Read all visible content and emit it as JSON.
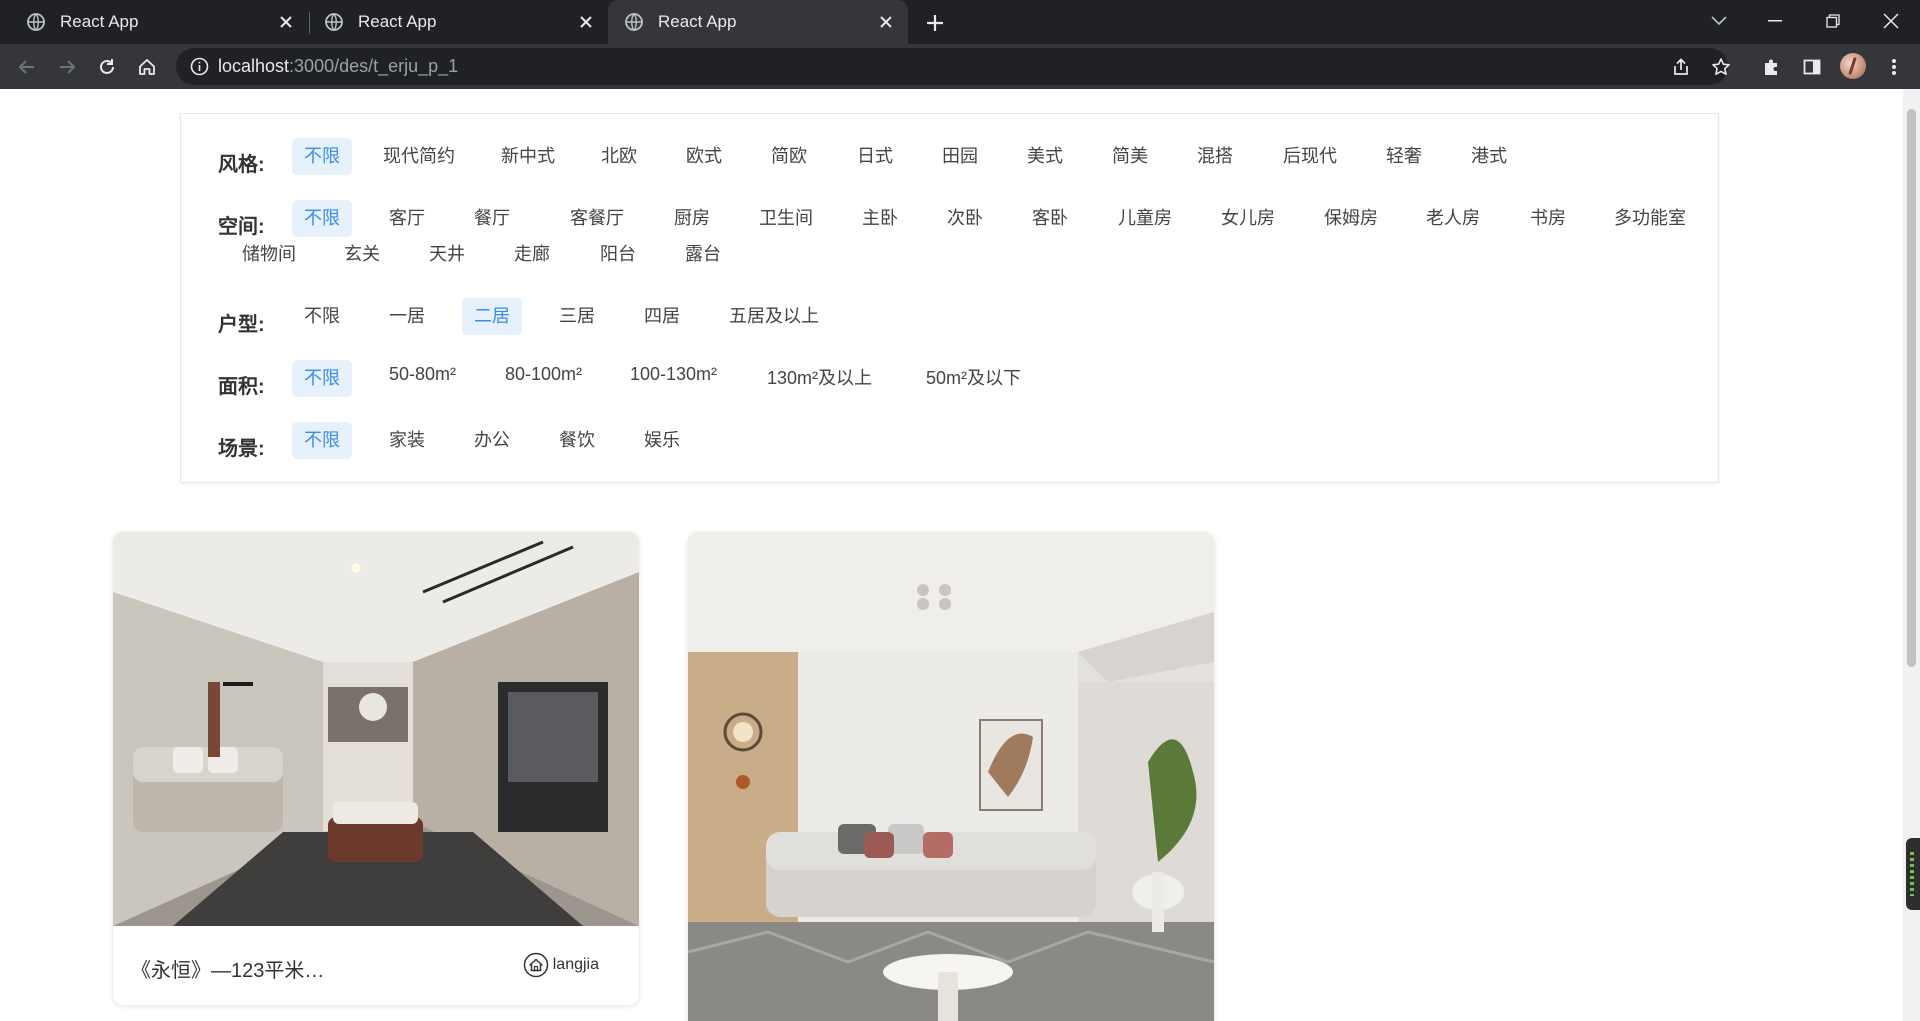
{
  "browser": {
    "tabs": [
      {
        "title": "React App",
        "active": false
      },
      {
        "title": "React App",
        "active": false
      },
      {
        "title": "React App",
        "active": true
      }
    ],
    "url": {
      "host": "localhost",
      "path": ":3000/des/t_erju_p_1"
    }
  },
  "filters": [
    {
      "label": "风格:",
      "options": [
        "不限",
        "现代简约",
        "新中式",
        "北欧",
        "欧式",
        "简欧",
        "日式",
        "田园",
        "美式",
        "简美",
        "混搭",
        "后现代",
        "轻奢",
        "港式"
      ],
      "selected": 0
    },
    {
      "label": "空间:",
      "options": [
        "不限",
        "客厅",
        "餐厅",
        "客餐厅",
        "厨房",
        "卫生间",
        "主卧",
        "次卧",
        "客卧",
        "儿童房",
        "女儿房",
        "保姆房",
        "老人房",
        "书房",
        "多功能室",
        "储物间",
        "玄关",
        "天井",
        "走廊",
        "阳台",
        "露台"
      ],
      "selected": 0
    },
    {
      "label": "户型:",
      "options": [
        "不限",
        "一居",
        "二居",
        "三居",
        "四居",
        "五居及以上"
      ],
      "selected": 2
    },
    {
      "label": "面积:",
      "options": [
        "不限",
        "50-80m²",
        "80-100m²",
        "100-130m²",
        "130m²及以上",
        "50m²及以下"
      ],
      "selected": 0
    },
    {
      "label": "场景:",
      "options": [
        "不限",
        "家装",
        "办公",
        "餐饮",
        "娱乐"
      ],
      "selected": 0
    }
  ],
  "cards": [
    {
      "title": "《永恒》—123平米…",
      "author": "langjia"
    },
    {
      "title": "",
      "author": ""
    }
  ],
  "colors": {
    "accent": "#3a8ee6",
    "selected_bg": "#e6f1fc",
    "chrome_dark": "#202124",
    "chrome": "#35363a"
  }
}
